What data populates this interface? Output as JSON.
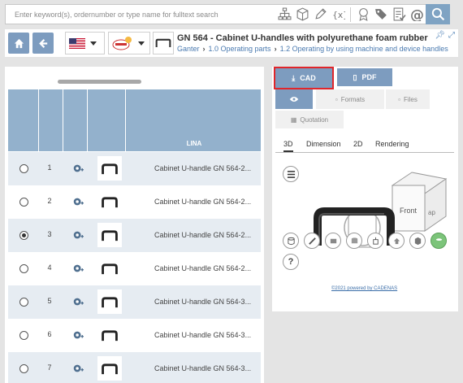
{
  "search": {
    "placeholder": "Enter keyword(s), ordernumber or type name for fulltext search"
  },
  "toolbar_icons": [
    "sitemap-icon",
    "cube-icon",
    "pencil-icon",
    "variable-icon",
    "certificate-icon",
    "tags-icon",
    "checklist-icon",
    "at-icon",
    "search-icon"
  ],
  "header": {
    "language_flag": "us-flag-icon",
    "catalog_logo": "ganter-logo",
    "title": "GN 564 - Cabinet U-handles with polyurethane foam rubber",
    "breadcrumb": [
      "Ganter",
      "1.0 Operating parts",
      "1.2 Operating by using machine and device handles"
    ]
  },
  "table": {
    "header_label": "LINA",
    "rows": [
      {
        "num": "1",
        "name": "Cabinet U-handle GN 564-2...",
        "selected": false
      },
      {
        "num": "2",
        "name": "Cabinet U-handle GN 564-2...",
        "selected": false
      },
      {
        "num": "3",
        "name": "Cabinet U-handle GN 564-2...",
        "selected": true
      },
      {
        "num": "4",
        "name": "Cabinet U-handle GN 564-2...",
        "selected": false
      },
      {
        "num": "5",
        "name": "Cabinet U-handle GN 564-3...",
        "selected": false
      },
      {
        "num": "6",
        "name": "Cabinet U-handle GN 564-3...",
        "selected": false
      },
      {
        "num": "7",
        "name": "Cabinet U-handle GN 564-3...",
        "selected": false
      }
    ]
  },
  "right": {
    "cad_label": "CAD",
    "pdf_label": "PDF",
    "formats_label": "Formats",
    "files_label": "Files",
    "quotation_label": "Quotation",
    "view_tabs": [
      "3D",
      "Dimension",
      "2D",
      "Rendering"
    ],
    "cube_front": "Front",
    "powered_by": "©2021 powered by CADENAS"
  },
  "colors": {
    "accent": "#7d9cbf",
    "table_header": "#93b1cc",
    "row_alt": "#e6ecf2",
    "highlight": "#e0262b"
  }
}
